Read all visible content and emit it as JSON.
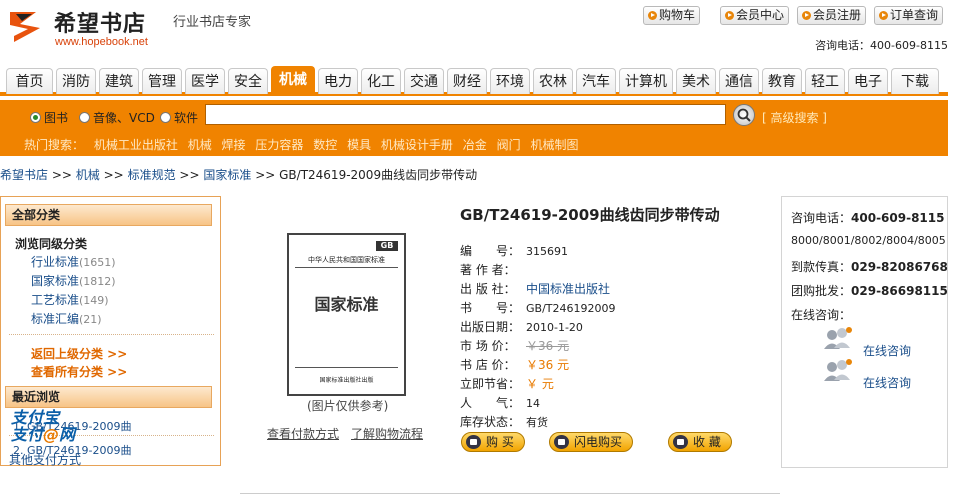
{
  "header": {
    "site_name": "希望书店",
    "site_url": "www.hopebook.net",
    "slogan": "行业书店专家",
    "top_buttons": [
      "购物车",
      "会员中心",
      "会员注册",
      "订单查询"
    ],
    "hotline": "咨询电话：400-609-8115"
  },
  "nav": {
    "tabs": [
      "首页",
      "消防",
      "建筑",
      "管理",
      "医学",
      "安全",
      "机械",
      "电力",
      "化工",
      "交通",
      "财经",
      "环境",
      "农林",
      "汽车",
      "计算机",
      "美术",
      "通信",
      "教育",
      "轻工",
      "电子",
      "下载"
    ],
    "active": "机械"
  },
  "search": {
    "options": [
      "图书",
      "音像、VCD",
      "软件"
    ],
    "selected": "图书",
    "value": "",
    "advanced": "[ 高级搜索 ]",
    "hot_label": "热门搜索：",
    "hot_terms": [
      "机械工业出版社",
      "机械",
      "焊接",
      "压力容器",
      "数控",
      "模具",
      "机械设计手册",
      "冶金",
      "阀门",
      "机械制图"
    ],
    "colors": {
      "accent": "#f08300"
    }
  },
  "breadcrumb": [
    "希望书店",
    "机械",
    "标准规范",
    "国家标准"
  ],
  "breadcrumb_current": "GB/T24619-2009曲线齿同步带传动",
  "breadcrumb_sep": ">>",
  "sidebar": {
    "all_categories": "全部分类",
    "same_level": "浏览同级分类",
    "items": [
      {
        "label": "行业标准",
        "count": "(1651)"
      },
      {
        "label": "国家标准",
        "count": "(1812)"
      },
      {
        "label": "工艺标准",
        "count": "(149)"
      },
      {
        "label": "标准汇编",
        "count": "(21)"
      }
    ],
    "back_up": "返回上级分类 >>",
    "view_all": "查看所有分类 >>",
    "recent_title": "最近浏览",
    "recent": [
      "1. GB/T24619-2009曲",
      "2. GB/T24619-2009曲"
    ]
  },
  "product": {
    "title": "GB/T24619-2009曲线齿同步带传动",
    "cover_caption": "(图片仅供参考)",
    "cover_header": "中华人民共和国国家标准",
    "cover_text": "国家标准",
    "cover_mark": "GB",
    "cover_footer": "国家标准出版社出版",
    "pay_method": "查看付款方式",
    "shopping_flow": "了解购物流程",
    "fields": [
      {
        "label": "编　　号：",
        "value": "315691"
      },
      {
        "label": "著 作 者：",
        "value": ""
      },
      {
        "label": "出 版 社：",
        "value": "中国标准出版社"
      },
      {
        "label": "书　　号：",
        "value": "GB/T246192009"
      },
      {
        "label": "出版日期：",
        "value": "2010-1-20"
      },
      {
        "label": "市 场 价：",
        "value": "￥36 元"
      },
      {
        "label": "书 店 价：",
        "value": "￥36 元"
      },
      {
        "label": "立即节省：",
        "value": "￥ 元"
      },
      {
        "label": "人　　气：",
        "value": "14"
      },
      {
        "label": "库存状态：",
        "value": "有货"
      }
    ],
    "actions": [
      "购 买",
      "闪电购买",
      "收 藏"
    ]
  },
  "contact": {
    "hotline_label": "咨询电话：",
    "hotline": "400-609-8115",
    "lines": "8000/8001/8002/8004/8005",
    "fax_label": "到款传真：",
    "fax": "029-82086768",
    "group_label": "团购批发：",
    "group": "029-86698115",
    "online_label": "在线咨询：",
    "consult": [
      "在线咨询",
      "在线咨询"
    ],
    "alipay_line1": "支付宝",
    "alipay_line2": "支付",
    "alipay_at": "@",
    "alipay_line3": "网",
    "other_pay": "其他支付方式"
  }
}
